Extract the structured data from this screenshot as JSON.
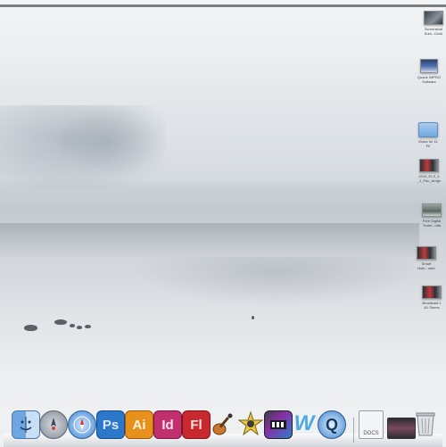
{
  "desktop": {
    "icons": [
      {
        "label": "Screenshot\nSum...Dock",
        "thumb": "screenshot-dark"
      },
      {
        "label": "Quartz IMPRO\nSoftware",
        "thumb": "screen"
      },
      {
        "label": "Music for 11\nFil",
        "thumb": "folder"
      },
      {
        "label": "2010_ELS_4\n_1_Pac_Ardgn",
        "thumb": "video"
      },
      {
        "label": "Free Digital\nTrane...nda",
        "thumb": "photo"
      },
      {
        "label": "Smart\nHoth...nder",
        "thumb": "video"
      },
      {
        "label": "Broadcast 1\nA1 Stores",
        "thumb": "video"
      }
    ]
  },
  "dock": {
    "items": [
      {
        "name": "finder",
        "label": ""
      },
      {
        "name": "launchpad",
        "label": ""
      },
      {
        "name": "safari",
        "label": ""
      },
      {
        "name": "photoshop",
        "label": "Ps"
      },
      {
        "name": "illustrator",
        "label": "Ai"
      },
      {
        "name": "indesign",
        "label": "Id"
      },
      {
        "name": "flash",
        "label": "Fl"
      },
      {
        "name": "garageband",
        "label": ""
      },
      {
        "name": "imovie",
        "label": ""
      },
      {
        "name": "final-cut",
        "label": ""
      },
      {
        "name": "dreamweaver",
        "label": "W"
      },
      {
        "name": "quicktime",
        "label": "Q"
      },
      {
        "name": "documents",
        "label": "DOCS"
      },
      {
        "name": "photos-stack",
        "label": ""
      },
      {
        "name": "trash",
        "label": ""
      }
    ],
    "colors": {
      "photoshop": "#2b77c9",
      "illustrator": "#e8901c",
      "indesign": "#c0306c",
      "flash": "#c7292f"
    }
  }
}
